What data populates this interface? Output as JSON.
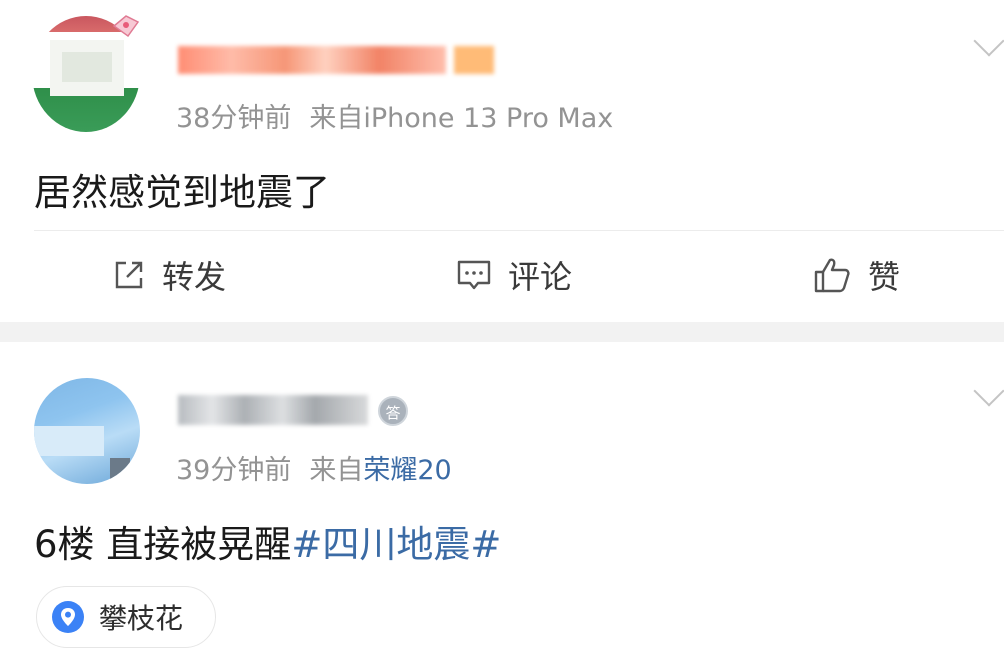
{
  "posts": [
    {
      "time": "38分钟前",
      "from_prefix": "来自",
      "device": "iPhone 13 Pro Max",
      "content": "居然感觉到地震了",
      "actions": {
        "repost": "转发",
        "comment": "评论",
        "like": "赞"
      }
    },
    {
      "medal_glyph": "答",
      "time": "39分钟前",
      "from_prefix": "来自",
      "device": "荣耀20",
      "content": "6楼 直接被晃醒",
      "hashtag": "#四川地震#",
      "location": "攀枝花"
    }
  ],
  "colors": {
    "link_blue": "#3b6ba5",
    "meta_gray": "#939393",
    "location_pin": "#3b82f6"
  },
  "icons": [
    "share-icon",
    "comment-icon",
    "like-icon",
    "chevron-down-icon",
    "location-pin-icon",
    "medal-icon"
  ]
}
